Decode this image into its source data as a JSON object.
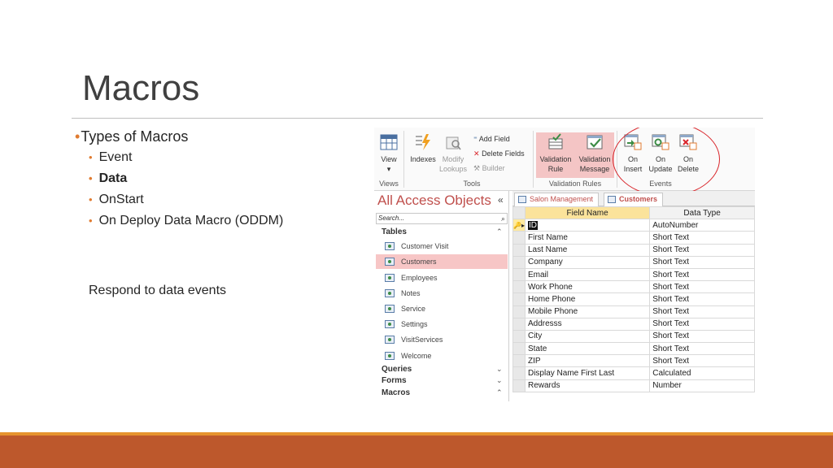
{
  "slide": {
    "title": "Macros",
    "bullets": [
      {
        "text": "Types of Macros",
        "level": 1,
        "bold": false
      },
      {
        "text": "Event",
        "level": 2,
        "bold": false
      },
      {
        "text": "Data",
        "level": 2,
        "bold": true
      },
      {
        "text": "OnStart",
        "level": 2,
        "bold": false
      },
      {
        "text": "On Deploy Data Macro (ODDM)",
        "level": 2,
        "bold": false
      }
    ],
    "note": "Respond to data events",
    "colors": {
      "accent": "#e07b30",
      "footer": "#bd582c",
      "footer_line": "#e6932e"
    }
  },
  "ribbon": {
    "view": {
      "label": "View",
      "arrow": "▾",
      "icon": "table-view-icon"
    },
    "indexes": {
      "label": "Indexes",
      "icon": "lightning-icon"
    },
    "modify_lookups": {
      "label1": "Modify",
      "label2": "Lookups",
      "icon": "lookup-icon"
    },
    "add_field": "Add Field",
    "delete_fields": "Delete Fields",
    "builder": "Builder",
    "validation_rule": {
      "label1": "Validation",
      "label2": "Rule"
    },
    "validation_message": {
      "label1": "Validation",
      "label2": "Message"
    },
    "on_insert": {
      "label1": "On",
      "label2": "Insert"
    },
    "on_update": {
      "label1": "On",
      "label2": "Update"
    },
    "on_delete": {
      "label1": "On",
      "label2": "Delete"
    },
    "groups": {
      "views": "Views",
      "tools": "Tools",
      "validation": "Validation Rules",
      "events": "Events"
    }
  },
  "nav": {
    "title": "All Access Objects",
    "collapse": "«",
    "search_placeholder": "Search...",
    "groups": {
      "tables": "Tables",
      "queries": "Queries",
      "forms": "Forms",
      "macros": "Macros"
    },
    "chevrons": {
      "up": "⌃",
      "down": "⌄"
    },
    "items": [
      "Customer Visit",
      "Customers",
      "Employees",
      "Notes",
      "Service",
      "Settings",
      "VisitServices",
      "Welcome"
    ],
    "selected": "Customers"
  },
  "tabs": [
    {
      "label": "Salon Management",
      "active": false
    },
    {
      "label": "Customers",
      "active": true
    }
  ],
  "grid": {
    "headers": [
      "Field Name",
      "Data Type"
    ],
    "key_marker": "🔑▸",
    "rows": [
      {
        "field": "ID",
        "type": "AutoNumber"
      },
      {
        "field": "First Name",
        "type": "Short Text"
      },
      {
        "field": "Last Name",
        "type": "Short Text"
      },
      {
        "field": "Company",
        "type": "Short Text"
      },
      {
        "field": "Email",
        "type": "Short Text"
      },
      {
        "field": "Work Phone",
        "type": "Short Text"
      },
      {
        "field": "Home Phone",
        "type": "Short Text"
      },
      {
        "field": "Mobile Phone",
        "type": "Short Text"
      },
      {
        "field": "Addresss",
        "type": "Short Text"
      },
      {
        "field": "City",
        "type": "Short Text"
      },
      {
        "field": "State",
        "type": "Short Text"
      },
      {
        "field": "ZIP",
        "type": "Short Text"
      },
      {
        "field": "Display Name First Last",
        "type": "Calculated"
      },
      {
        "field": "Rewards",
        "type": "Number"
      }
    ]
  }
}
